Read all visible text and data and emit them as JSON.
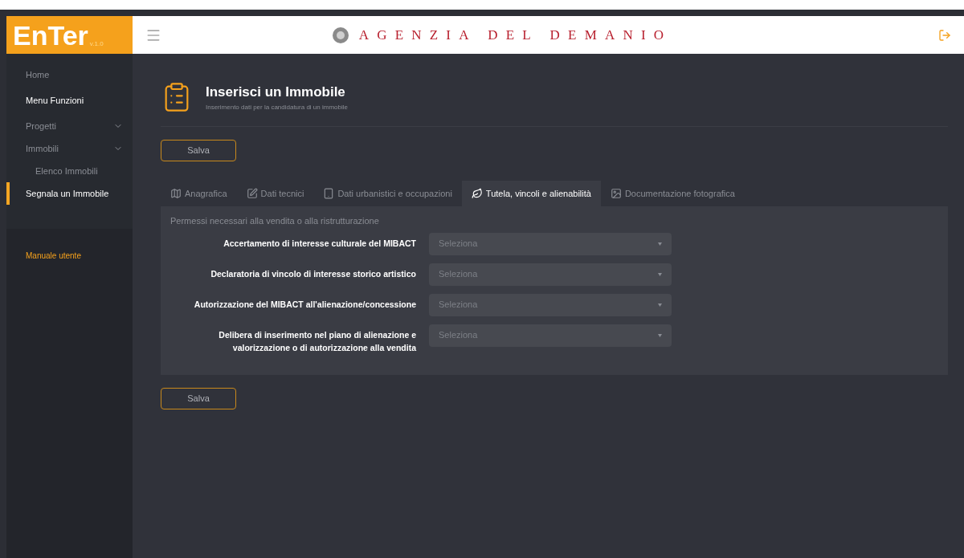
{
  "logo": {
    "name": "EnTer",
    "version": "v.1.0"
  },
  "header": {
    "title": "AGENZIA DEL DEMANIO"
  },
  "sidebar": {
    "items": [
      {
        "label": "Home",
        "kind": "link",
        "selected": false
      },
      {
        "label": "Menu Funzioni",
        "kind": "heading",
        "selected": false
      },
      {
        "label": "Progetti",
        "kind": "group",
        "selected": false
      },
      {
        "label": "Immobili",
        "kind": "group",
        "selected": false
      },
      {
        "label": "Elenco Immobili",
        "kind": "subitem",
        "selected": false
      },
      {
        "label": "Segnala un Immobile",
        "kind": "link",
        "selected": true
      }
    ],
    "manual": "Manuale utente"
  },
  "page": {
    "title": "Inserisci un Immobile",
    "subtitle": "Inserimento dati per la candidatura di un immobile"
  },
  "save_top": "Salva",
  "tabs": [
    {
      "label": "Anagrafica",
      "selected": false
    },
    {
      "label": "Dati tecnici",
      "selected": false
    },
    {
      "label": "Dati urbanistici e occupazioni",
      "selected": false
    },
    {
      "label": "Tutela, vincoli e alienabilità",
      "selected": true
    },
    {
      "label": "Documentazione fotografica",
      "selected": false
    }
  ],
  "section": {
    "title": "Permessi necessari alla vendita o alla ristrutturazione",
    "fields": [
      {
        "label": "Accertamento di interesse culturale del MIBACT",
        "placeholder": "Seleziona"
      },
      {
        "label": "Declaratoria di vincolo di interesse storico artistico",
        "placeholder": "Seleziona"
      },
      {
        "label": "Autorizzazione del MIBACT all'alienazione/concessione",
        "placeholder": "Seleziona"
      },
      {
        "label": "Delibera di inserimento nel piano di alienazione e valorizzazione o di autorizzazione alla vendita",
        "placeholder": "Seleziona"
      }
    ]
  },
  "save_bottom": "Salva"
}
